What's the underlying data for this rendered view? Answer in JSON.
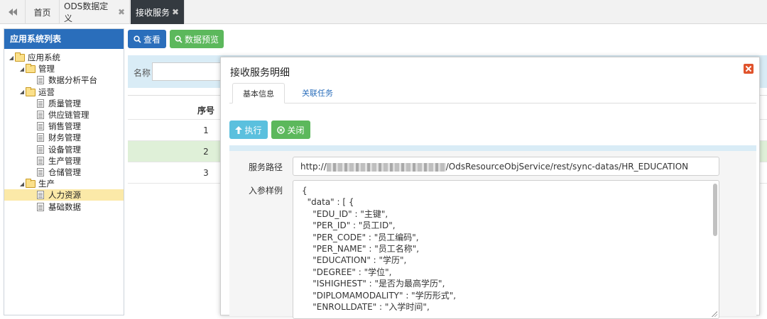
{
  "tabs": [
    {
      "label": "首页",
      "closable": false
    },
    {
      "label": "ODS数据定义",
      "closable": true
    },
    {
      "label": "接收服务",
      "closable": true,
      "active": true
    }
  ],
  "sidebar": {
    "title": "应用系统列表",
    "tree": [
      {
        "label": "应用系统",
        "type": "folder",
        "depth": 0,
        "expanded": true
      },
      {
        "label": "管理",
        "type": "folder",
        "depth": 1,
        "expanded": true
      },
      {
        "label": "数据分析平台",
        "type": "file",
        "depth": 2
      },
      {
        "label": "运营",
        "type": "folder",
        "depth": 1,
        "expanded": true
      },
      {
        "label": "质量管理",
        "type": "file",
        "depth": 2
      },
      {
        "label": "供应链管理",
        "type": "file",
        "depth": 2
      },
      {
        "label": "销售管理",
        "type": "file",
        "depth": 2
      },
      {
        "label": "财务管理",
        "type": "file",
        "depth": 2
      },
      {
        "label": "设备管理",
        "type": "file",
        "depth": 2
      },
      {
        "label": "生产管理",
        "type": "file",
        "depth": 2
      },
      {
        "label": "仓储管理",
        "type": "file",
        "depth": 2
      },
      {
        "label": "生产",
        "type": "folder",
        "depth": 1,
        "expanded": true
      },
      {
        "label": "人力资源",
        "type": "file",
        "depth": 2,
        "selected": true
      },
      {
        "label": "基础数据",
        "type": "file",
        "depth": 2
      }
    ]
  },
  "toolbar": {
    "view_label": "查看",
    "preview_label": "数据预览"
  },
  "search": {
    "name_label": "名称",
    "name_value": ""
  },
  "grid": {
    "header_seq": "序号",
    "rows": [
      "1",
      "2",
      "3"
    ]
  },
  "modal": {
    "title": "接收服务明细",
    "tabs": [
      "基本信息",
      "关联任务"
    ],
    "execute_label": "执行",
    "close_label": "关闭",
    "path_label": "服务路径",
    "path_prefix": "http://",
    "path_suffix": "/OdsResourceObjService/rest/sync-datas/HR_EDUCATION",
    "param_label": "入参样例",
    "param_lines": [
      "{",
      "  \"data\" : [ {",
      "    \"EDU_ID\" : \"主键\",",
      "    \"PER_ID\" : \"员工ID\",",
      "    \"PER_CODE\" : \"员工编码\",",
      "    \"PER_NAME\" : \"员工名称\",",
      "    \"EDUCATION\" : \"学历\",",
      "    \"DEGREE\" : \"学位\",",
      "    \"ISHIGHEST\" : \"是否为最高学历\",",
      "    \"DIPLOMAMODALITY\" : \"学历形式\",",
      "    \"ENROLLDATE\" : \"入学时间\","
    ]
  },
  "colors": {
    "primary": "#2a6ebb",
    "success": "#5cb85c",
    "info": "#5bc0de",
    "tab_active_bg": "#343a40",
    "selected_row": "#dff0d8",
    "selected_tree": "#fbe9a8",
    "close_icon": "#e0532c"
  }
}
